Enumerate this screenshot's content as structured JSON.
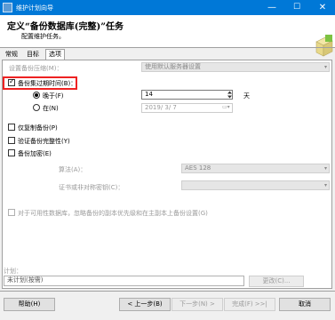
{
  "window": {
    "title": "维护计划向导",
    "minimize": "—",
    "maximize": "☐",
    "close": "✕"
  },
  "header": {
    "title": "定义“备份数据库(完整)”任务",
    "subtitle": "配置维护任务。"
  },
  "tabs": [
    {
      "label": "常规"
    },
    {
      "label": "目标"
    },
    {
      "label": "选项"
    }
  ],
  "options": {
    "compression_label": "设置备份压缩(M)：",
    "compression_value": "使用默认服务器设置",
    "expire_label": "备份集过期时间(B)：",
    "expire_checked": true,
    "after_label": "晚于(F)",
    "after_days": "14",
    "days_unit": "天",
    "on_label": "在(N)",
    "on_date": "2019/ 3/ 7",
    "copy_only_label": "仅复制备份(P)",
    "verify_label": "验证备份完整性(Y)",
    "encrypt_label": "备份加密(E)",
    "algorithm_label": "算法(A)：",
    "algorithm_value": "AES 128",
    "cert_label": "证书或非对称密钥(C)：",
    "cert_value": "",
    "availability_label": "对于可用性数据库，忽略备份的副本优先级和在主副本上备份设置(G)"
  },
  "schedule": {
    "label": "计划：",
    "value": "未计划(按需)",
    "change_button": "更改(C)..."
  },
  "footer": {
    "help": "帮助(H)",
    "back": "< 上一步(B)",
    "next": "下一步(N) >",
    "finish": "完成(F) >>|",
    "cancel": "取消"
  }
}
